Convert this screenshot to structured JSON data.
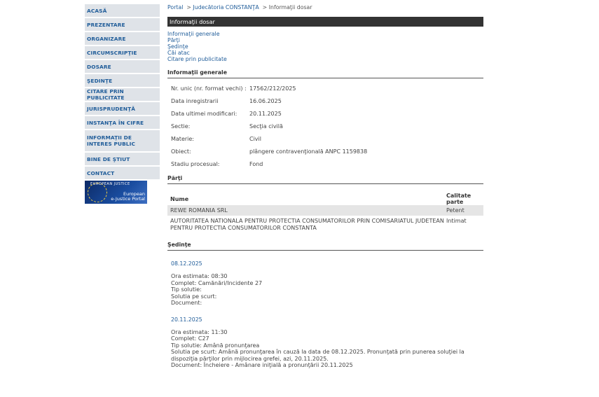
{
  "sidebar": {
    "items": [
      {
        "label": "ACASĂ"
      },
      {
        "label": "PREZENTARE"
      },
      {
        "label": "ORGANIZARE"
      },
      {
        "label": "CIRCUMSCRIPŢIE"
      },
      {
        "label": "DOSARE"
      },
      {
        "label": "ŞEDINŢE"
      },
      {
        "label": "CITARE PRIN PUBLICITATE"
      },
      {
        "label": "JURISPRUDENŢĂ"
      },
      {
        "label": "INSTANŢA ÎN CIFRE"
      },
      {
        "label": "INFORMAŢII DE INTERES PUBLIC"
      },
      {
        "label": "BINE DE ŞTIUT"
      },
      {
        "label": "CONTACT"
      }
    ],
    "banner": {
      "top": "EUROPEAN JUSTICE",
      "line1": "European",
      "line2": "e-Justice Portal"
    }
  },
  "breadcrumb": {
    "portal": "Portal",
    "sep": ">",
    "court": "Judecătoria CONSTANŢA",
    "current": "Informaţii dosar"
  },
  "header": {
    "title": "Informaţii dosar"
  },
  "quick_links": [
    "Informaţii generale",
    "Părţi",
    "Şedinţe",
    "Căi atac",
    "Citare prin publicitate"
  ],
  "general": {
    "title": "Informaţii generale",
    "rows": [
      {
        "label": "Nr. unic (nr. format vechi) :",
        "value": "17562/212/2025"
      },
      {
        "label": "Data inregistrarii",
        "value": "16.06.2025"
      },
      {
        "label": "Data ultimei modificari:",
        "value": "20.11.2025"
      },
      {
        "label": "Sectie:",
        "value": "Secţia civilă"
      },
      {
        "label": "Materie:",
        "value": "Civil"
      },
      {
        "label": "Obiect:",
        "value": "plângere contravenţională ANPC 1159838"
      },
      {
        "label": "Stadiu procesual:",
        "value": "Fond"
      }
    ]
  },
  "parti": {
    "title": "Părţi",
    "col_name": "Nume",
    "col_calitate": "Calitate parte",
    "rows": [
      {
        "name": "REWE ROMANIA SRL",
        "calitate": "Petent"
      },
      {
        "name": "AUTORITATEA NATIONALA PENTRU PROTECTIA CONSUMATORILOR PRIN COMISARIATUL JUDETEAN PENTRU PROTECTIA CONSUMATORILOR CONSTANTA",
        "calitate": "Intimat"
      }
    ]
  },
  "sedinte": {
    "title": "Şedinţe",
    "items": [
      {
        "date": "08.12.2025",
        "ora": "Ora estimata: 08:30",
        "complet": "Complet: Camănări/Incidente 27",
        "tip": "Tip solutie:",
        "solutia": "Solutia pe scurt:",
        "document": "Document:"
      },
      {
        "date": "20.11.2025",
        "ora": "Ora estimata: 11:30",
        "complet": "Complet: C27",
        "tip": "Tip solutie: Amână pronunţarea",
        "solutia": "Solutia pe scurt: Amână pronunţarea în cauză la data de 08.12.2025. Pronunţată prin punerea soluţiei la dispoziţia părţilor prin mijlocirea grefei, azi, 20.11.2025.",
        "document": "Document: Încheiere - Amânare iniţială a pronunţării    20.11.2025"
      }
    ]
  },
  "colors": {
    "link": "#1f5c99",
    "header_bg": "#333333",
    "sidebar_bg": "#dfe3e8"
  }
}
